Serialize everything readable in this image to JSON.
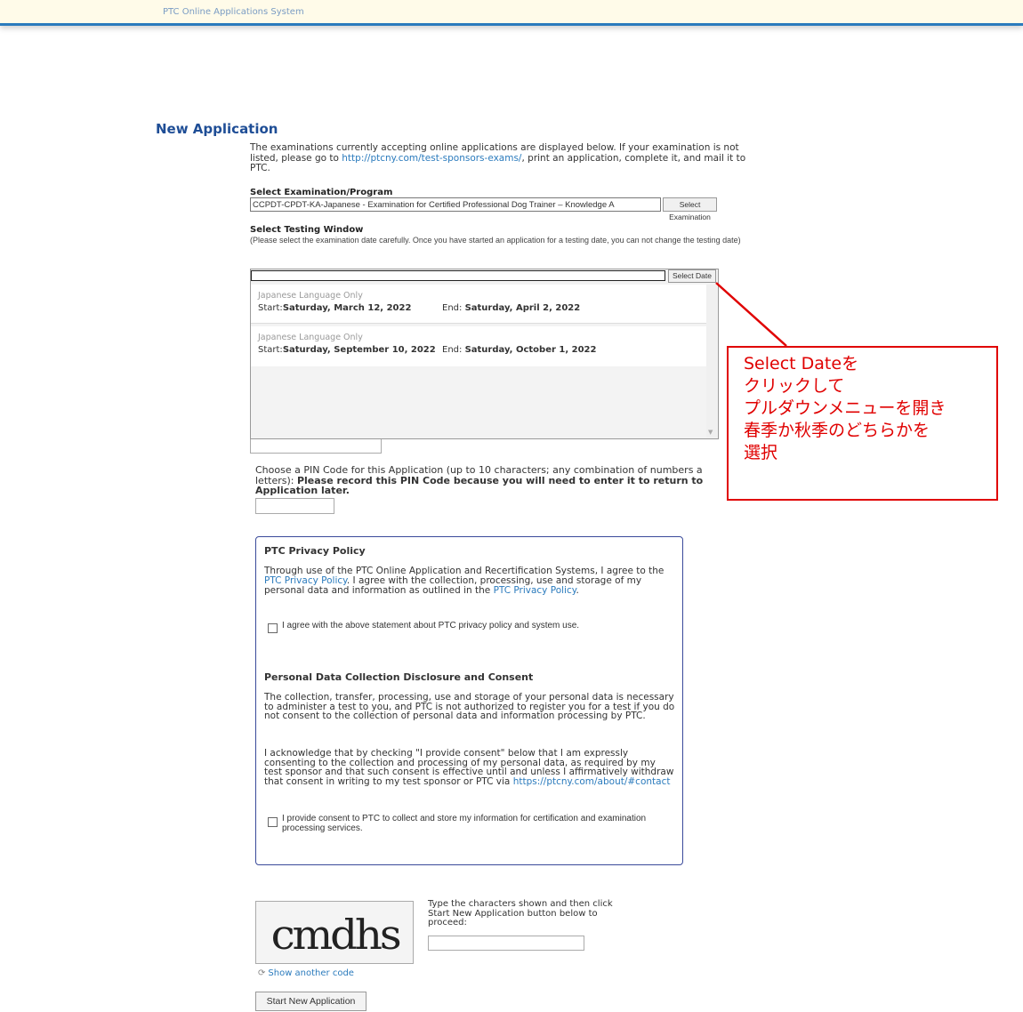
{
  "header": {
    "system_name": "PTC Online Applications System"
  },
  "page": {
    "title": "New Application",
    "intro_before_link": "The examinations currently accepting online applications are displayed below. If your examination is not listed, please go to ",
    "intro_link": "http://ptcny.com/test-sponsors-exams/",
    "intro_after_link": ", print an application, complete it, and mail it to PTC."
  },
  "exam": {
    "label": "Select Examination/Program",
    "selected_value": "CCPDT-CPDT-KA-Japanese - Examination for Certified Professional Dog Trainer – Knowledge A",
    "button_label": "Select Examination"
  },
  "testing_window": {
    "label": "Select Testing Window",
    "note": "(Please select the examination date carefully. Once you have started an application for a testing date, you can not change the testing date)",
    "button_label": "Select Date",
    "options": [
      {
        "language": "Japanese Language Only",
        "start_label": "Start:",
        "start": "Saturday, March 12, 2022",
        "end_label": "End:",
        "end": "Saturday, April 2, 2022"
      },
      {
        "language": "Japanese Language Only",
        "start_label": "Start:",
        "start": "Saturday, September 10, 2022",
        "end_label": "End:",
        "end": "Saturday, October 1, 2022"
      }
    ]
  },
  "pin": {
    "text_plain": "Choose a PIN Code for this Application (up to 10 characters; any combination of numbers a",
    "text_plain2": "letters): ",
    "text_bold": "Please record this PIN Code because you will need to enter it to return to",
    "text_bold2": "Application later."
  },
  "privacy": {
    "title": "PTC Privacy Policy",
    "text_1": "Through use of the PTC Online Application and Recertification Systems, I agree to the ",
    "link_1": "PTC Privacy Policy",
    "text_2": ". I agree with the collection, processing, use and storage of my personal data and information as outlined in the ",
    "link_2": "PTC Privacy Policy",
    "text_3": ".",
    "checkbox_label": "I agree with the above statement about PTC privacy policy and system use."
  },
  "personal_data": {
    "title": "Personal Data Collection Disclosure and Consent",
    "paragraph_1": "The collection, transfer, processing, use and storage of your personal data is necessary to administer a test to you, and PTC is not authorized to register you for a test if you do not consent to the collection of personal data and information processing by PTC.",
    "paragraph_2": "I acknowledge that by checking \"I provide consent\" below that I am expressly consenting to the collection and processing of my personal data, as required by my test sponsor and that such consent is effective until and unless I affirmatively withdraw that consent in writing to my test sponsor or PTC via ",
    "contact_link": "https://ptcny.com/about/#contact",
    "checkbox_label": "I provide consent to PTC to collect and store my information for certification and examination processing services."
  },
  "captcha": {
    "code": "cmdhs",
    "instructions": "Type the characters shown and then click Start New Application button below to proceed:",
    "refresh_label": "Show another code"
  },
  "actions": {
    "start_label": "Start New Application"
  },
  "annotation": {
    "lines": [
      "Select Dateを",
      "クリックして",
      "プルダウンメニューを開き",
      "春季か秋季のどちらかを",
      "選択"
    ],
    "color": "#e00000"
  },
  "colors": {
    "title": "#1f4e96",
    "link": "#2b7bbd",
    "header_bar": "#2b7bbd"
  }
}
